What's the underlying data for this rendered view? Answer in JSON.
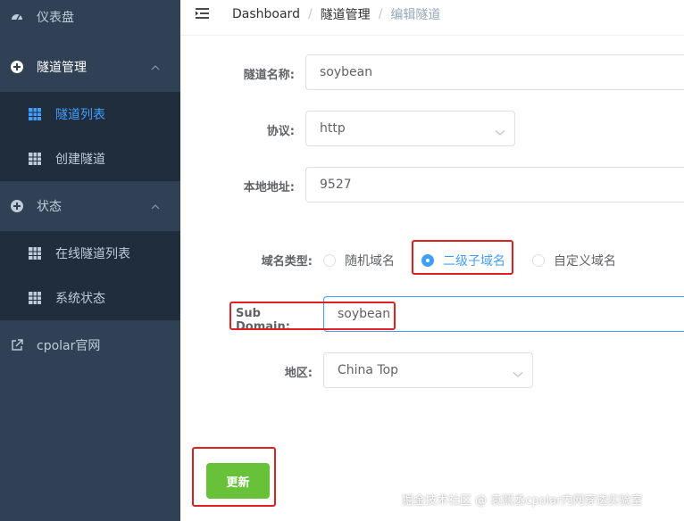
{
  "sidebar": {
    "dashboard": {
      "label": "仪表盘",
      "icon": "dashboard-icon"
    },
    "tunnel_mgmt": {
      "label": "隧道管理",
      "icon": "tunnel-icon",
      "children": [
        {
          "label": "隧道列表",
          "icon": "grid-icon",
          "active": true
        },
        {
          "label": "创建隧道",
          "icon": "grid-icon",
          "active": false
        }
      ]
    },
    "status": {
      "label": "状态",
      "icon": "status-icon",
      "children": [
        {
          "label": "在线隧道列表",
          "icon": "grid-icon"
        },
        {
          "label": "系统状态",
          "icon": "grid-icon"
        }
      ]
    },
    "cpolar": {
      "label": "cpolar官网",
      "icon": "external-link-icon"
    }
  },
  "breadcrumb": [
    "Dashboard",
    "隧道管理",
    "编辑隧道"
  ],
  "form": {
    "tunnel_name": {
      "label": "隧道名称:",
      "value": "soybean"
    },
    "protocol": {
      "label": "协议:",
      "value": "http"
    },
    "local_addr": {
      "label": "本地地址:",
      "value": "9527"
    },
    "domain_type": {
      "label": "域名类型:",
      "options": [
        "随机域名",
        "二级子域名",
        "自定义域名"
      ],
      "selected": "二级子域名"
    },
    "sub_domain": {
      "label": "Sub Domain:",
      "value": "soybean"
    },
    "region": {
      "label": "地区:",
      "value": "China Top"
    },
    "submit_label": "更新"
  },
  "watermark": "掘金技术社区 @ 袁熙丞cpolar内网穿透实验室",
  "colors": {
    "sidebar_bg": "#304156",
    "submenu_bg": "#1f2d3d",
    "accent": "#409eff",
    "success": "#67c23a",
    "highlight": "#e02020"
  }
}
